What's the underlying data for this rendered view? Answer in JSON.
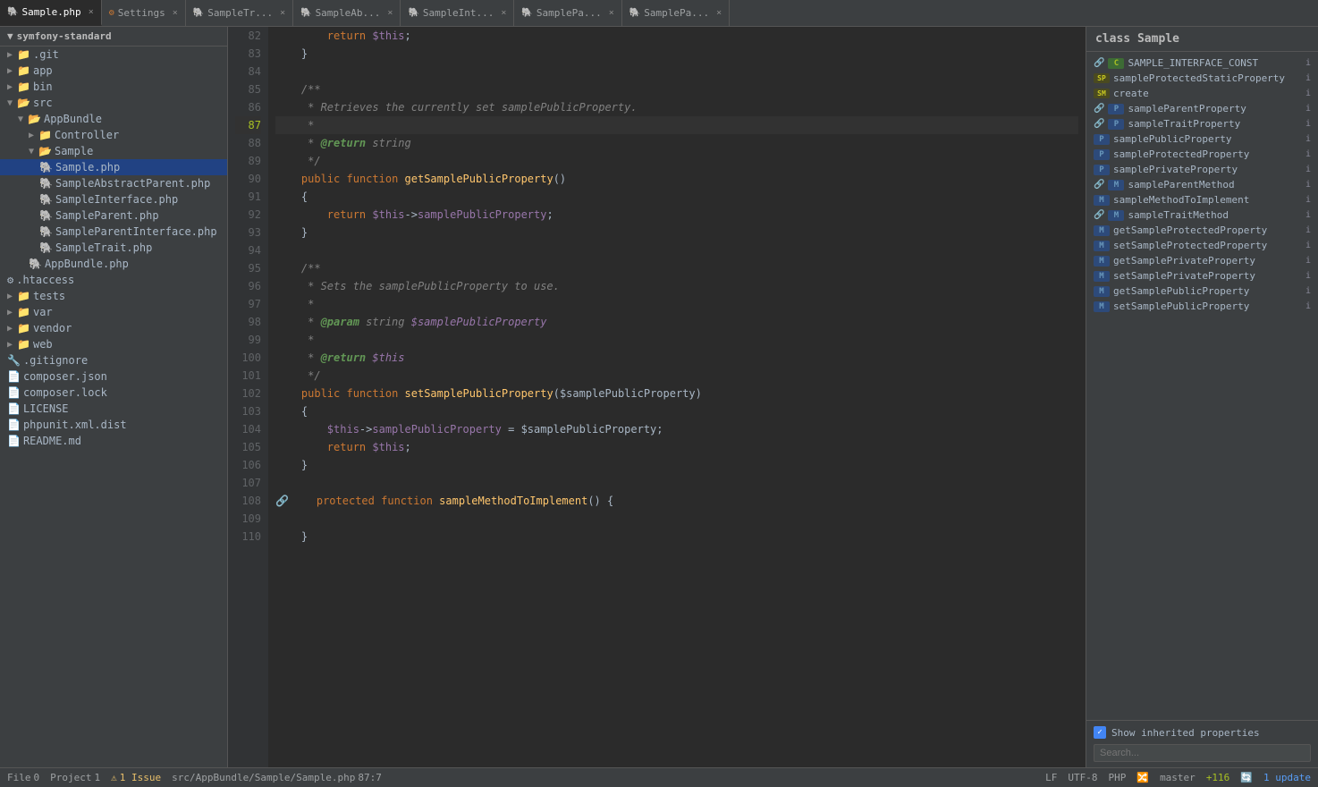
{
  "window_title": "symfony-standard",
  "tabs": [
    {
      "label": "Sample.php",
      "active": true,
      "closable": true
    },
    {
      "label": "Settings",
      "active": false,
      "closable": true
    },
    {
      "label": "SampleTr...",
      "active": false,
      "closable": true
    },
    {
      "label": "SampleAb...",
      "active": false,
      "closable": true
    },
    {
      "label": "SampleInt...",
      "active": false,
      "closable": true
    },
    {
      "label": "SamplePa...",
      "active": false,
      "closable": true
    },
    {
      "label": "SamplePa...",
      "active": false,
      "closable": true
    }
  ],
  "sidebar": {
    "title": "symfony-standard",
    "items": [
      {
        "id": "git",
        "label": ".git",
        "indent": 1,
        "type": "folder",
        "expanded": false
      },
      {
        "id": "app",
        "label": "app",
        "indent": 1,
        "type": "folder",
        "expanded": false
      },
      {
        "id": "bin",
        "label": "bin",
        "indent": 1,
        "type": "folder",
        "expanded": false
      },
      {
        "id": "src",
        "label": "src",
        "indent": 1,
        "type": "folder",
        "expanded": true
      },
      {
        "id": "AppBundle",
        "label": "AppBundle",
        "indent": 2,
        "type": "folder",
        "expanded": true
      },
      {
        "id": "Controller",
        "label": "Controller",
        "indent": 3,
        "type": "folder",
        "expanded": false
      },
      {
        "id": "Sample",
        "label": "Sample",
        "indent": 3,
        "type": "folder",
        "expanded": true
      },
      {
        "id": "Sample.php",
        "label": "Sample.php",
        "indent": 4,
        "type": "php",
        "selected": true
      },
      {
        "id": "SampleAbstractParent.php",
        "label": "SampleAbstractParent.php",
        "indent": 4,
        "type": "php"
      },
      {
        "id": "SampleInterface.php",
        "label": "SampleInterface.php",
        "indent": 4,
        "type": "php"
      },
      {
        "id": "SampleParent.php",
        "label": "SampleParent.php",
        "indent": 4,
        "type": "php"
      },
      {
        "id": "SampleParentInterface.php",
        "label": "SampleParentInterface.php",
        "indent": 4,
        "type": "php"
      },
      {
        "id": "SampleTrait.php",
        "label": "SampleTrait.php",
        "indent": 4,
        "type": "php"
      },
      {
        "id": "AppBundle.php",
        "label": "AppBundle.php",
        "indent": 3,
        "type": "php"
      },
      {
        "id": "htaccess",
        "label": ".htaccess",
        "indent": 1,
        "type": "config"
      },
      {
        "id": "tests",
        "label": "tests",
        "indent": 1,
        "type": "folder",
        "expanded": false
      },
      {
        "id": "var",
        "label": "var",
        "indent": 1,
        "type": "folder",
        "expanded": false
      },
      {
        "id": "vendor",
        "label": "vendor",
        "indent": 1,
        "type": "folder",
        "expanded": false
      },
      {
        "id": "web",
        "label": "web",
        "indent": 1,
        "type": "folder",
        "expanded": false
      },
      {
        "id": "gitignore",
        "label": ".gitignore",
        "indent": 1,
        "type": "text"
      },
      {
        "id": "composer.json",
        "label": "composer.json",
        "indent": 1,
        "type": "json"
      },
      {
        "id": "composer.lock",
        "label": "composer.lock",
        "indent": 1,
        "type": "text"
      },
      {
        "id": "LICENSE",
        "label": "LICENSE",
        "indent": 1,
        "type": "text"
      },
      {
        "id": "phpunit.xml.dist",
        "label": "phpunit.xml.dist",
        "indent": 1,
        "type": "xml"
      },
      {
        "id": "README.md",
        "label": "README.md",
        "indent": 1,
        "type": "md"
      }
    ]
  },
  "right_panel": {
    "title": "class Sample",
    "items": [
      {
        "badge": "C",
        "badge_type": "C",
        "label": "SAMPLE_INTERFACE_CONST",
        "inherited": true,
        "info": "i"
      },
      {
        "badge": "SP",
        "badge_type": "SP",
        "label": "sampleProtectedStaticProperty",
        "inherited": false,
        "info": "i"
      },
      {
        "badge": "SM",
        "badge_type": "SM",
        "label": "create",
        "inherited": false,
        "info": "i"
      },
      {
        "badge": "P",
        "badge_type": "P",
        "label": "sampleParentProperty",
        "inherited": true,
        "info": "i"
      },
      {
        "badge": "P",
        "badge_type": "P",
        "label": "sampleTraitProperty",
        "inherited": true,
        "info": "i"
      },
      {
        "badge": "P",
        "badge_type": "P",
        "label": "samplePublicProperty",
        "inherited": false,
        "info": "i"
      },
      {
        "badge": "P",
        "badge_type": "P",
        "label": "sampleProtectedProperty",
        "inherited": false,
        "info": "i"
      },
      {
        "badge": "P",
        "badge_type": "P",
        "label": "samplePrivateProperty",
        "inherited": false,
        "info": "i"
      },
      {
        "badge": "M",
        "badge_type": "M",
        "label": "sampleParentMethod",
        "inherited": true,
        "info": "i"
      },
      {
        "badge": "M",
        "badge_type": "M",
        "label": "sampleMethodToImplement",
        "inherited": false,
        "info": "i"
      },
      {
        "badge": "M",
        "badge_type": "M",
        "label": "sampleTraitMethod",
        "inherited": true,
        "info": "i"
      },
      {
        "badge": "M",
        "badge_type": "M",
        "label": "getSampleProtectedProperty",
        "inherited": false,
        "info": "i"
      },
      {
        "badge": "M",
        "badge_type": "M",
        "label": "setSampleProtectedProperty",
        "inherited": false,
        "info": "i"
      },
      {
        "badge": "M",
        "badge_type": "M",
        "label": "getSamplePrivateProperty",
        "inherited": false,
        "info": "i"
      },
      {
        "badge": "M",
        "badge_type": "M",
        "label": "setSamplePrivateProperty",
        "inherited": false,
        "info": "i"
      },
      {
        "badge": "M",
        "badge_type": "M",
        "label": "getSamplePublicProperty",
        "inherited": false,
        "info": "i"
      },
      {
        "badge": "M",
        "badge_type": "M",
        "label": "setSamplePublicProperty",
        "inherited": false,
        "info": "i"
      }
    ],
    "show_inherited_label": "Show inherited properties",
    "search_placeholder": "Search..."
  },
  "status_bar": {
    "file_label": "File",
    "file_count": "0",
    "project_label": "Project",
    "project_count": "1",
    "issue_count": "1 Issue",
    "file_path": "src/AppBundle/Sample/Sample.php",
    "position": "87:7",
    "line_ending": "LF",
    "encoding": "UTF-8",
    "lang": "PHP",
    "vcs": "master",
    "vcs_changes": "+116",
    "updates": "1 update"
  },
  "lines": [
    {
      "num": 82,
      "content": "        return $this;"
    },
    {
      "num": 83,
      "content": "    }"
    },
    {
      "num": 84,
      "content": ""
    },
    {
      "num": 85,
      "content": "    /**"
    },
    {
      "num": 86,
      "content": "     * Retrieves the currently set samplePublicProperty."
    },
    {
      "num": 87,
      "content": "     *",
      "current": true
    },
    {
      "num": 88,
      "content": "     * @return string"
    },
    {
      "num": 89,
      "content": "     */"
    },
    {
      "num": 90,
      "content": "    public function getSamplePublicProperty()"
    },
    {
      "num": 91,
      "content": "    {"
    },
    {
      "num": 92,
      "content": "        return $this->samplePublicProperty;"
    },
    {
      "num": 93,
      "content": "    }"
    },
    {
      "num": 94,
      "content": ""
    },
    {
      "num": 95,
      "content": "    /**"
    },
    {
      "num": 96,
      "content": "     * Sets the samplePublicProperty to use."
    },
    {
      "num": 97,
      "content": "     *"
    },
    {
      "num": 98,
      "content": "     * @param string $samplePublicProperty"
    },
    {
      "num": 99,
      "content": "     *"
    },
    {
      "num": 100,
      "content": "     * @return $this"
    },
    {
      "num": 101,
      "content": "     */"
    },
    {
      "num": 102,
      "content": "    public function setSamplePublicProperty($samplePublicProperty)"
    },
    {
      "num": 103,
      "content": "    {"
    },
    {
      "num": 104,
      "content": "        $this->samplePublicProperty = $samplePublicProperty;"
    },
    {
      "num": 105,
      "content": "        return $this;"
    },
    {
      "num": 106,
      "content": "    }"
    },
    {
      "num": 107,
      "content": ""
    },
    {
      "num": 108,
      "content": "    protected function sampleMethodToImplement() {",
      "has_marker": true
    },
    {
      "num": 109,
      "content": ""
    },
    {
      "num": 110,
      "content": "    }"
    }
  ]
}
